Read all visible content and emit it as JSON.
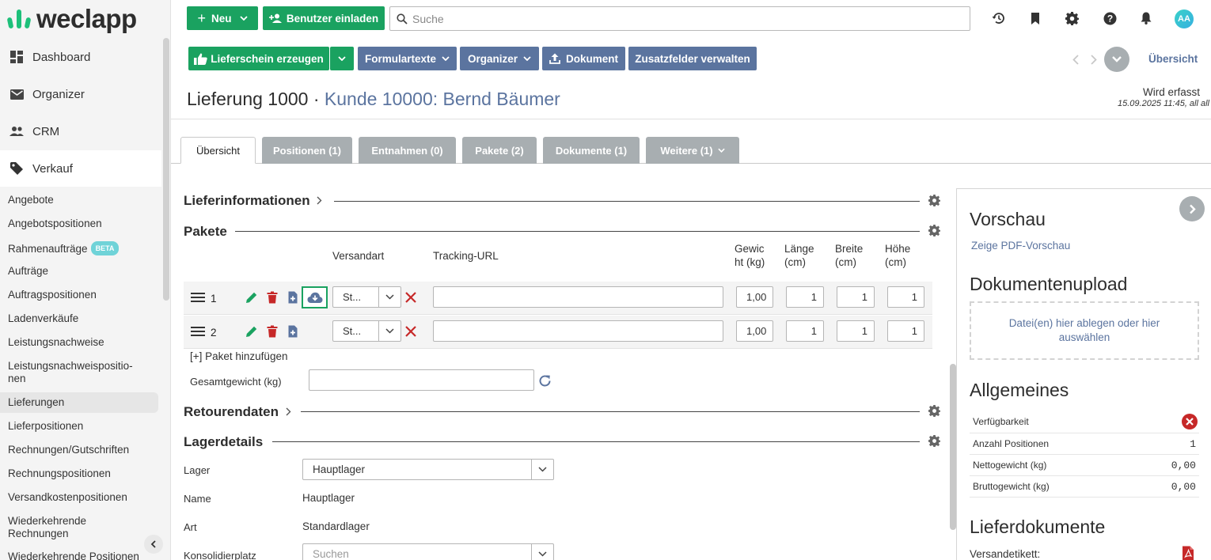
{
  "brand": {
    "name": "weclapp"
  },
  "sidebar": {
    "main": [
      {
        "label": "Dashboard",
        "icon": "dashboard-icon"
      },
      {
        "label": "Organizer",
        "icon": "mail-icon"
      },
      {
        "label": "CRM",
        "icon": "people-icon"
      },
      {
        "label": "Verkauf",
        "icon": "tag-icon"
      }
    ],
    "sub": [
      {
        "label": "Angebote"
      },
      {
        "label": "Angebotspositionen"
      },
      {
        "label": "Rahmenaufträge",
        "badge": "BETA"
      },
      {
        "label": "Aufträge"
      },
      {
        "label": "Auftragspositionen"
      },
      {
        "label": "Ladenverkäufe"
      },
      {
        "label": "Leistungsnachweise"
      },
      {
        "label": "Leistungsnachweispositio-\nnen"
      },
      {
        "label": "Lieferungen"
      },
      {
        "label": "Lieferpositionen"
      },
      {
        "label": "Rechnungen/Gutschriften"
      },
      {
        "label": "Rechnungspositionen"
      },
      {
        "label": "Versandkostenpositionen"
      },
      {
        "label": "Wiederkehrende\nRechnungen"
      },
      {
        "label": "Wiederkehrende Positionen"
      }
    ]
  },
  "header": {
    "new_label": "Neu",
    "invite_label": "Benutzer einladen",
    "search_placeholder": "Suche",
    "avatar_initials": "AA"
  },
  "toolbar": {
    "delivery_note": "Lieferschein erzeugen",
    "form_texts": "Formulartexte",
    "organizer": "Organizer",
    "document": "Dokument",
    "extra_fields": "Zusatzfelder verwalten",
    "overview_link": "Übersicht"
  },
  "title": {
    "prefix": "Lieferung 1000 · ",
    "customer": "Kunde 10000: Bernd Bäumer",
    "status": "Wird erfasst",
    "status_date": "15.09.2025 11:45, all all"
  },
  "tabs": [
    {
      "label": "Übersicht"
    },
    {
      "label": "Positionen (1)"
    },
    {
      "label": "Entnahmen (0)"
    },
    {
      "label": "Pakete (2)"
    },
    {
      "label": "Dokumente (1)"
    },
    {
      "label": "Weitere (1)"
    }
  ],
  "sections": {
    "delivery_info": "Lieferinformationen",
    "packages": "Pakete",
    "return_data": "Retourendaten",
    "stock_details": "Lagerdetails"
  },
  "packages": {
    "columns": {
      "shipping": "Versandart",
      "tracking": "Tracking-URL",
      "weight": "Gewic\nht (kg)",
      "length": "Länge\n(cm)",
      "width": "Breite\n(cm)",
      "height": "Höhe\n(cm)"
    },
    "rows": [
      {
        "no": "1",
        "shipping": "St...",
        "tracking": "",
        "weight": "1,00",
        "length": "1",
        "width": "1",
        "height": "1"
      },
      {
        "no": "2",
        "shipping": "St...",
        "tracking": "",
        "weight": "1,00",
        "length": "1",
        "width": "1",
        "height": "1"
      }
    ],
    "add_label": "[+] Paket hinzufügen",
    "total_weight_label": "Gesamtgewicht (kg)",
    "total_weight_value": ""
  },
  "stock": {
    "warehouse_label": "Lager",
    "warehouse_value": "Hauptlager",
    "name_label": "Name",
    "name_value": "Hauptlager",
    "type_label": "Art",
    "type_value": "Standardlager",
    "consolidation_label": "Konsolidierplatz",
    "consolidation_placeholder": "Suchen"
  },
  "right_panel": {
    "preview_title": "Vorschau",
    "preview_link": "Zeige PDF-Vorschau",
    "upload_title": "Dokumentenupload",
    "upload_text": "Datei(en) hier ablegen oder hier auswählen",
    "general_title": "Allgemeines",
    "general": [
      {
        "label": "Verfügbarkeit",
        "value": ""
      },
      {
        "label": "Anzahl Positionen",
        "value": "1"
      },
      {
        "label": "Nettogewicht (kg)",
        "value": "0,00"
      },
      {
        "label": "Bruttogewicht (kg)",
        "value": "0,00"
      }
    ],
    "docs_title": "Lieferdokumente",
    "shipping_label": "Versandetikett:"
  },
  "colors": {
    "green": "#1aa260",
    "blue": "#5b749f",
    "tab_grey": "#a8aeb1",
    "error_red": "#c62828"
  }
}
